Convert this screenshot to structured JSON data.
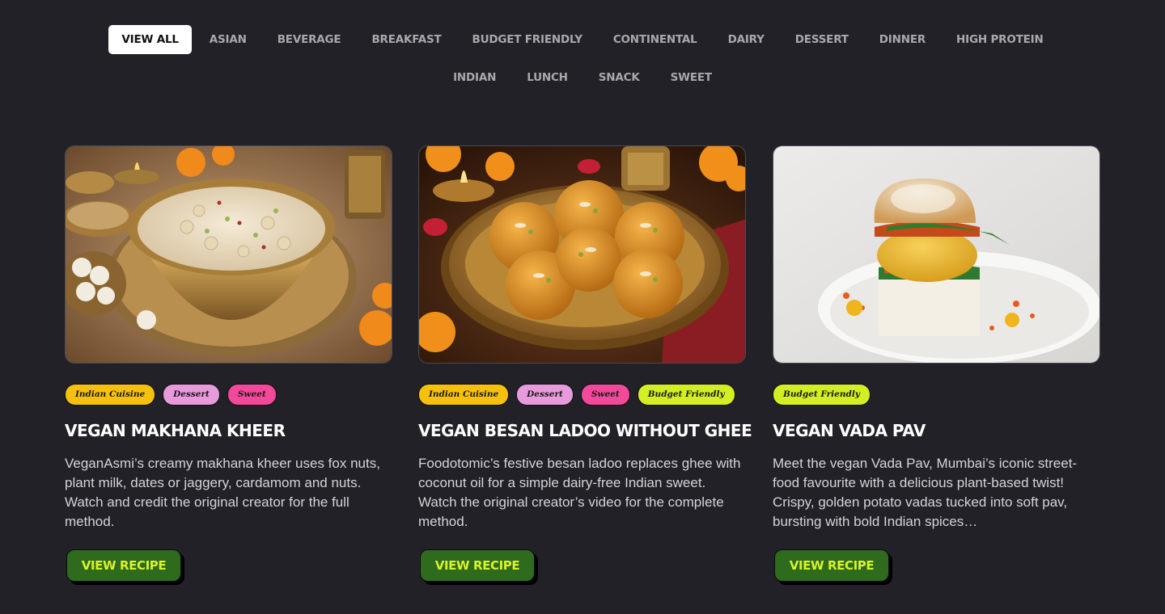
{
  "filters": {
    "items": [
      "VIEW ALL",
      "ASIAN",
      "BEVERAGE",
      "BREAKFAST",
      "BUDGET FRIENDLY",
      "CONTINENTAL",
      "DAIRY",
      "DESSERT",
      "DINNER",
      "HIGH PROTEIN",
      "INDIAN",
      "LUNCH",
      "SNACK",
      "SWEET"
    ],
    "active": "VIEW ALL"
  },
  "recipes": [
    {
      "title": "VEGAN MAKHANA KHEER",
      "tags": [
        "Indian Cuisine",
        "Dessert",
        "Sweet"
      ],
      "description": "VeganAsmi’s creamy makhana kheer uses fox nuts, plant milk, dates or jaggery, cardamom and nuts. Watch and credit the original creator for the full method.",
      "button_label": "VIEW RECIPE",
      "image_icon": "bowl-of-kheer-photo"
    },
    {
      "title": "VEGAN BESAN LADOO WITHOUT GHEE",
      "tags": [
        "Indian Cuisine",
        "Dessert",
        "Sweet",
        "Budget Friendly"
      ],
      "description": "Foodotomic’s festive besan ladoo replaces ghee with coconut oil for a simple dairy-free Indian sweet. Watch the original creator’s video for the complete method.",
      "button_label": "VIEW RECIPE",
      "image_icon": "plate-of-ladoos-photo"
    },
    {
      "title": "VEGAN VADA PAV",
      "tags": [
        "Budget Friendly"
      ],
      "description": "Meet the vegan Vada Pav, Mumbai’s iconic street-food favourite with a delicious plant-based twist! Crispy, golden potato vadas tucked into soft pav, bursting with bold Indian spices…",
      "button_label": "VIEW RECIPE",
      "image_icon": "vada-pav-photo"
    }
  ],
  "colors": {
    "background": "#222127",
    "button": "#2e6b1d",
    "button_text": "#d8f22d",
    "tag_indian": "#f6c10e",
    "tag_dessert": "#e79bdd",
    "tag_sweet": "#f2499a",
    "tag_budget": "#d3ef24"
  }
}
